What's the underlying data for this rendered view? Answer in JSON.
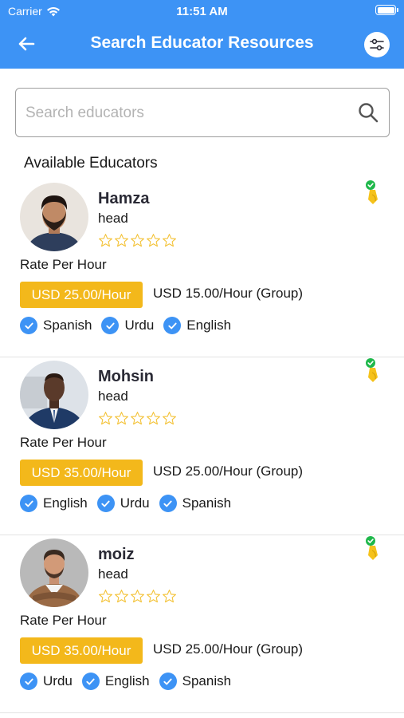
{
  "status_bar": {
    "carrier": "Carrier",
    "time": "11:51 AM"
  },
  "header": {
    "title": "Search Educator Resources",
    "back_icon": "arrow-left-icon",
    "filter_icon": "sliders-icon"
  },
  "search": {
    "placeholder": "Search educators",
    "value": ""
  },
  "section_title": "Available Educators",
  "colors": {
    "primary": "#3d93f5",
    "accent": "#f3b81b",
    "verified": "#1fb84b"
  },
  "educators": [
    {
      "name": "Hamza",
      "role": "head",
      "rating": 0,
      "rate_label": "Rate Per Hour",
      "price": "USD 25.00/Hour",
      "group_price": "USD 15.00/Hour (Group)",
      "languages": [
        "Spanish",
        "Urdu",
        "English"
      ]
    },
    {
      "name": "Mohsin",
      "role": "head",
      "rating": 0,
      "rate_label": "Rate Per Hour",
      "price": "USD 35.00/Hour",
      "group_price": "USD 25.00/Hour (Group)",
      "languages": [
        "English",
        "Urdu",
        "Spanish"
      ]
    },
    {
      "name": "moiz",
      "role": "head",
      "rating": 0,
      "rate_label": "Rate Per Hour",
      "price": "USD 35.00/Hour",
      "group_price": "USD 25.00/Hour (Group)",
      "languages": [
        "Urdu",
        "English",
        "Spanish"
      ]
    }
  ]
}
